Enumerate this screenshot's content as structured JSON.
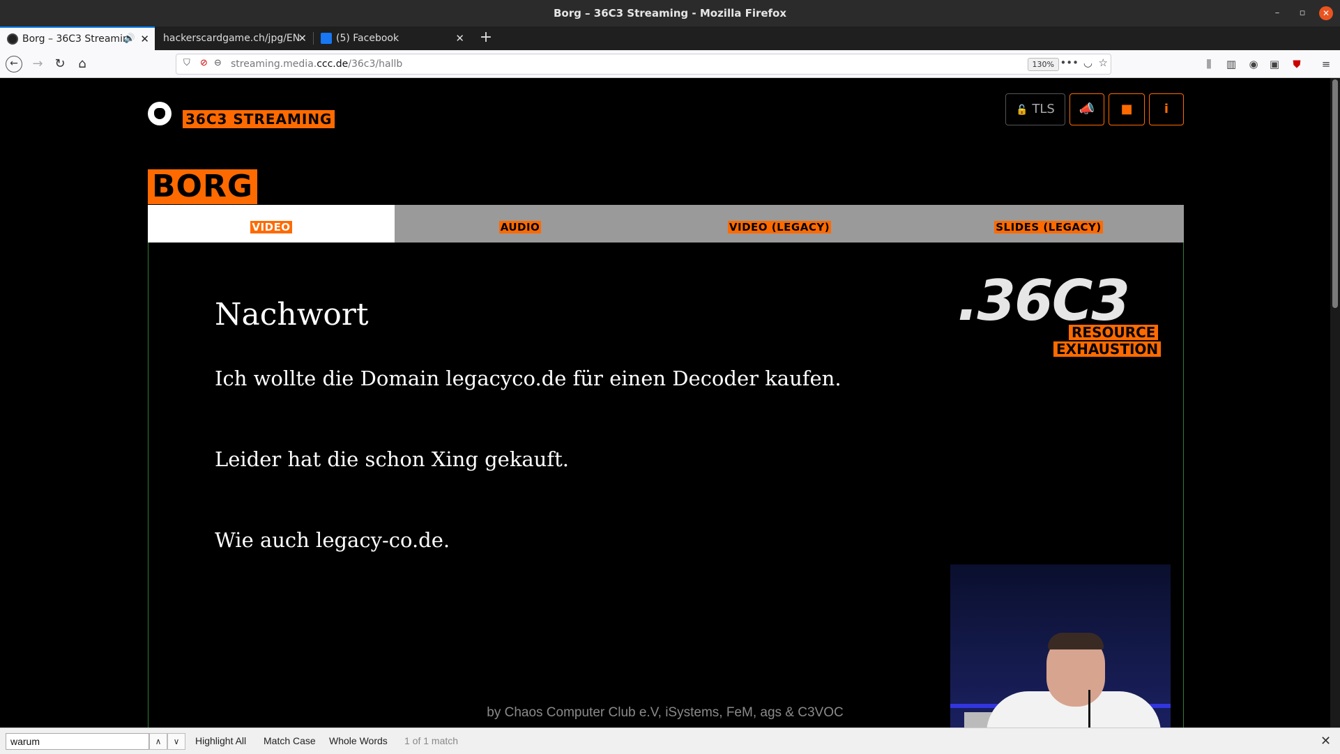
{
  "window": {
    "title": "Borg – 36C3 Streaming - Mozilla Firefox",
    "minimize": "–",
    "restore": "▫",
    "close": "✕"
  },
  "tabs": [
    {
      "title": "Borg – 36C3 Streamin",
      "active": true
    },
    {
      "title": "hackerscardgame.ch/jpg/EN",
      "active": false
    },
    {
      "title": "(5) Facebook",
      "active": false
    }
  ],
  "navbar": {
    "url_prefix": "streaming.media.",
    "url_host": "ccc.de",
    "url_path": "/36c3/hallb",
    "zoom": "130%"
  },
  "site": {
    "logo_text": "36C3 STREAMING",
    "tls_label": "TLS",
    "room_title": "BORG",
    "stream_tabs": [
      "VIDEO",
      "AUDIO",
      "VIDEO (LEGACY)",
      "SLIDES (LEGACY)"
    ],
    "footer": "by Chaos Computer Club e.V, iSystems, FeM, ags & C3VOC"
  },
  "slide": {
    "title": "Nachwort",
    "lines": [
      "Ich wollte die Domain legacyco.de für einen Decoder kaufen.",
      "Leider hat die schon Xing gekauft.",
      "Wie auch legacy-co.de."
    ],
    "logo_main": ".36C3",
    "logo_sub1": "RESOURCE",
    "logo_sub2": "EXHAUSTION"
  },
  "findbar": {
    "query": "warum",
    "highlight_all": "Highlight All",
    "match_case": "Match Case",
    "whole_words": "Whole Words",
    "status": "1 of 1 match"
  },
  "colors": {
    "accent": "#ff6a00",
    "player_border": "#2e7d32",
    "footer_text": "#8a8a8a"
  }
}
